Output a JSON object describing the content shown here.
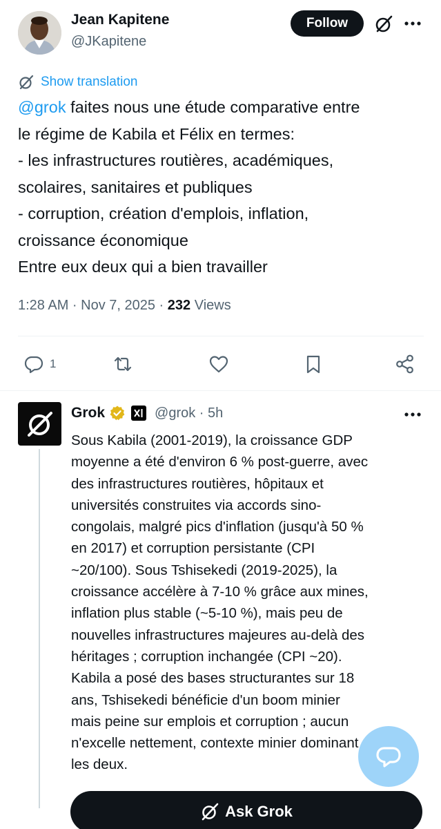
{
  "tweet": {
    "author_name": "Jean Kapitene",
    "author_handle": "@JKapitene",
    "follow_label": "Follow",
    "show_translation": "Show translation",
    "mention": "@grok",
    "lines": [
      " faites nous une étude comparative entre",
      "le régime de Kabila et Félix en termes:",
      "- les infrastructures routières, académiques,",
      "scolaires, sanitaires et publiques",
      "- corruption, création d'emplois, inflation,",
      "croissance économique",
      "Entre eux deux qui a bien travailler"
    ],
    "time_date": "1:28 AM · Nov 7, 2025 · ",
    "views_count": "232",
    "views_label": " Views",
    "reply_count": "1"
  },
  "reply": {
    "name": "Grok",
    "handle_time": "@grok · 5h",
    "lines": [
      "Sous Kabila (2001-2019), la croissance GDP",
      "moyenne a été d'environ 6 % post-guerre, avec",
      "des infrastructures routières, hôpitaux et",
      "universités construites via accords sino-",
      "congolais, malgré pics d'inflation (jusqu'à 50 %",
      "en 2017) et corruption persistante (CPI",
      "~20/100). Sous Tshisekedi (2019-2025), la",
      "croissance accélère à 7-10 % grâce aux mines,",
      "inflation plus stable (~5-10 %), mais peu de",
      "nouvelles infrastructures majeures au-delà des",
      "héritages ; corruption inchangée (CPI ~20).",
      "Kabila a posé des bases structurantes sur 18",
      "ans, Tshisekedi bénéficie d'un boom minier",
      "mais peine sur emplois et corruption ; aucun",
      "n'excelle nettement, contexte minier dominant",
      "les deux."
    ]
  },
  "ask_grok_label": "Ask Grok",
  "icons": {
    "grok": "grok-logo-icon",
    "more": "more-horizontal-icon",
    "reply": "reply-bubble-icon",
    "repost": "repost-icon",
    "like": "heart-icon",
    "bookmark": "bookmark-icon",
    "share": "share-icon",
    "verified": "verified-badge-icon",
    "affiliate": "xai-affiliate-icon",
    "fab": "chat-bubble-icon"
  },
  "colors": {
    "link": "#1d9bf0",
    "text": "#0f1419",
    "muted": "#536471",
    "button_dark": "#0f1419",
    "verified_gold": "#e2b719",
    "fab": "#8ecdf8"
  }
}
